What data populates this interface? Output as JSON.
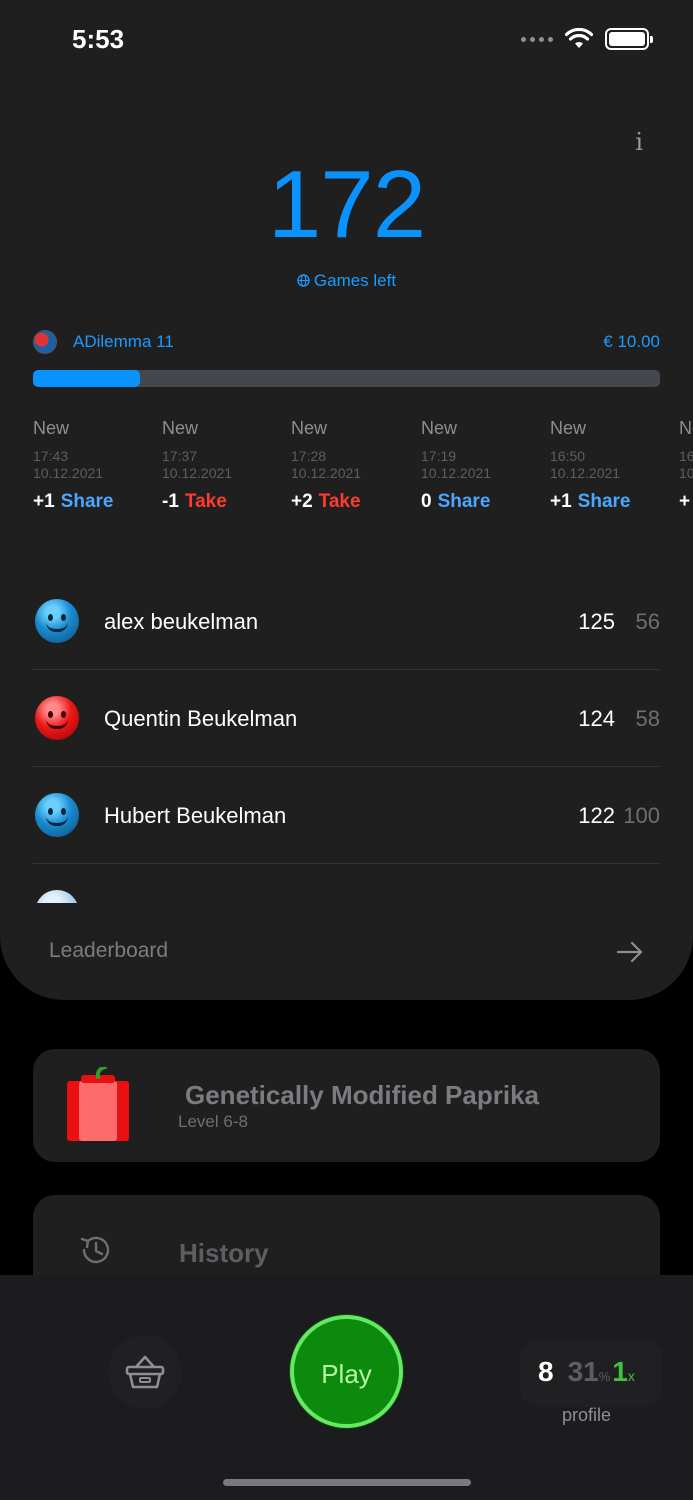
{
  "status_bar": {
    "time": "5:53"
  },
  "header": {
    "info_icon": "i",
    "games_left_count": "172",
    "games_left_label": "Games left"
  },
  "game": {
    "name": "ADilemma 11",
    "prize": "€ 10.00",
    "progress_fraction": 0.17
  },
  "moves": [
    {
      "status": "New",
      "time": "17:43",
      "date": "10.12.2021",
      "delta": "+1",
      "action": "Share"
    },
    {
      "status": "New",
      "time": "17:37",
      "date": "10.12.2021",
      "delta": "-1",
      "action": "Take"
    },
    {
      "status": "New",
      "time": "17:28",
      "date": "10.12.2021",
      "delta": "+2",
      "action": "Take"
    },
    {
      "status": "New",
      "time": "17:19",
      "date": "10.12.2021",
      "delta": "0",
      "action": "Share"
    },
    {
      "status": "New",
      "time": "16:50",
      "date": "10.12.2021",
      "delta": "+1",
      "action": "Share"
    },
    {
      "status": "New",
      "time": "16:",
      "date": "10.",
      "delta": "+",
      "action": ""
    }
  ],
  "leaderboard": {
    "rows": [
      {
        "name": "alex beukelman",
        "score": "125",
        "games": "56",
        "avatar": "blue-smiley-icon"
      },
      {
        "name": "Quentin Beukelman",
        "score": "124",
        "games": "58",
        "avatar": "red-devil-icon"
      },
      {
        "name": "Hubert  Beukelman",
        "score": "122",
        "games": "100",
        "avatar": "blue-smiley-icon"
      },
      {
        "name": "",
        "score": "",
        "games": "",
        "avatar": "grey-smiley-icon"
      }
    ],
    "footer_label": "Leaderboard"
  },
  "level": {
    "title": "Genetically Modified Paprika",
    "subtitle": "Level 6-8"
  },
  "history": {
    "label": "History"
  },
  "bottom_bar": {
    "play_label": "Play",
    "profile_level": "8",
    "profile_percent": "31",
    "profile_percent_symbol": "%",
    "profile_multiplier": "1",
    "profile_multiplier_symbol": "x",
    "profile_label": "profile"
  },
  "colors": {
    "accent": "#0a93ff",
    "take": "#ff3b30",
    "share": "#4ca6ff",
    "play": "#0b8a0b"
  }
}
